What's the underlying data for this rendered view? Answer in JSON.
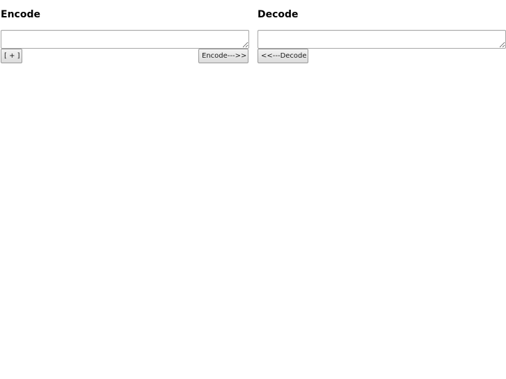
{
  "encode": {
    "heading": "Encode",
    "input_value": "",
    "add_label": "[ + ]",
    "encode_label": "Encode--->>"
  },
  "decode": {
    "heading": "Decode",
    "input_value": "",
    "decode_label": "<<---Decode"
  }
}
